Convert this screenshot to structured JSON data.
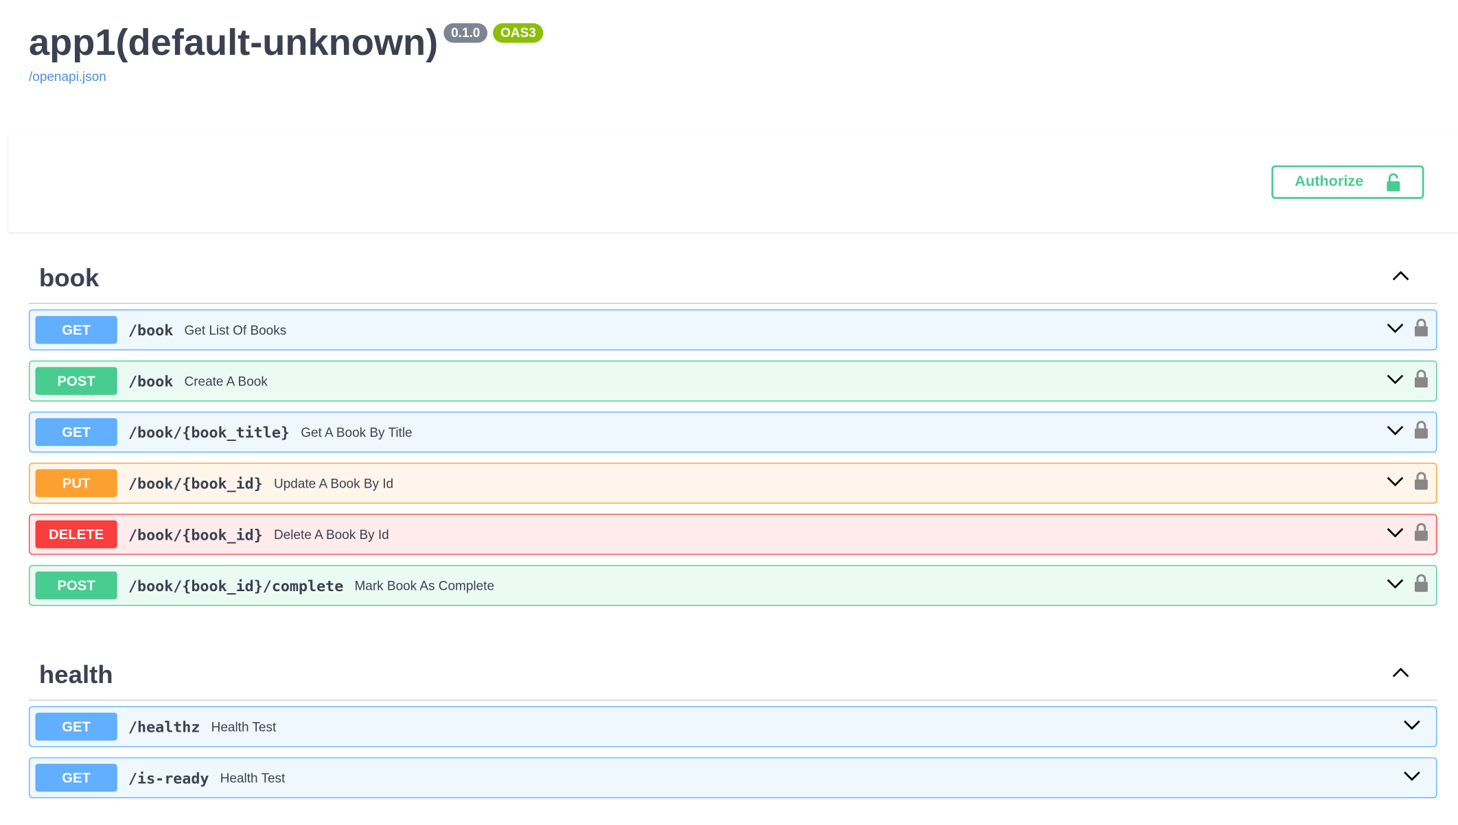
{
  "info": {
    "title": "app1(default-unknown)",
    "version": "0.1.0",
    "oas": "OAS3",
    "spec_link": "/openapi.json"
  },
  "authorize": {
    "label": "Authorize"
  },
  "tags": [
    {
      "name": "book",
      "operations": [
        {
          "method": "GET",
          "path": "/book",
          "summary": "Get List Of Books",
          "locked": true
        },
        {
          "method": "POST",
          "path": "/book",
          "summary": "Create A Book",
          "locked": true
        },
        {
          "method": "GET",
          "path": "/book/{book_title}",
          "summary": "Get A Book By Title",
          "locked": true
        },
        {
          "method": "PUT",
          "path": "/book/{book_id}",
          "summary": "Update A Book By Id",
          "locked": true
        },
        {
          "method": "DELETE",
          "path": "/book/{book_id}",
          "summary": "Delete A Book By Id",
          "locked": true
        },
        {
          "method": "POST",
          "path": "/book/{book_id}/complete",
          "summary": "Mark Book As Complete",
          "locked": true
        }
      ]
    },
    {
      "name": "health",
      "operations": [
        {
          "method": "GET",
          "path": "/healthz",
          "summary": "Health Test",
          "locked": false
        },
        {
          "method": "GET",
          "path": "/is-ready",
          "summary": "Health Test",
          "locked": false
        }
      ]
    }
  ],
  "colors": {
    "get": "#61affe",
    "post": "#49cc90",
    "put": "#fca130",
    "delete": "#f93e3e",
    "link": "#4990e2",
    "badge_version": "#7d8492",
    "badge_oas": "#89bf04"
  },
  "icons": {
    "lock_closed": "lock-icon",
    "lock_open": "unlock-icon",
    "expand": "chevron-down-icon",
    "collapse": "chevron-up-icon"
  }
}
